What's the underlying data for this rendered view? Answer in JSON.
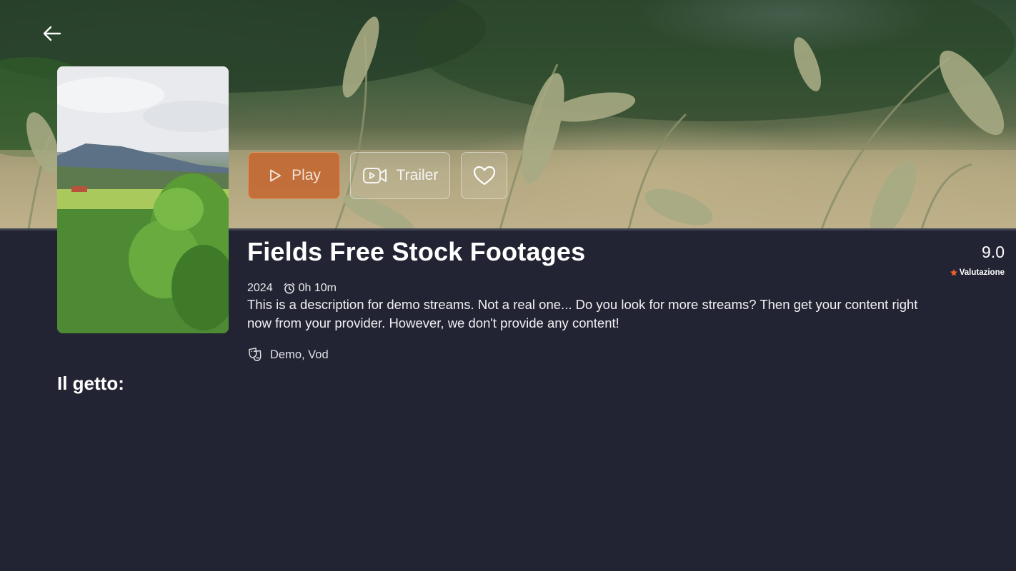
{
  "navigation": {
    "back_icon": "arrow-left-icon"
  },
  "actions": {
    "play_label": "Play",
    "play_icon": "play-icon",
    "trailer_label": "Trailer",
    "trailer_icon": "video-camera-icon",
    "favorite_icon": "heart-icon"
  },
  "movie": {
    "title": "Fields Free Stock Footages",
    "year": "2024",
    "duration": "0h 10m",
    "duration_icon": "alarm-clock-icon",
    "description": "This is a description for demo streams. Not a real one... Do you look for more streams? Then get your content right now from your provider. However, we don't provide any content!",
    "genres": "Demo, Vod",
    "genres_icon": "theater-masks-icon"
  },
  "rating": {
    "value": "9.0",
    "label": "Valutazione",
    "icon": "star-icon"
  },
  "cast": {
    "heading": "Il getto:"
  },
  "colors": {
    "background": "#232433",
    "accent": "#c46630",
    "star": "#f0622b"
  }
}
